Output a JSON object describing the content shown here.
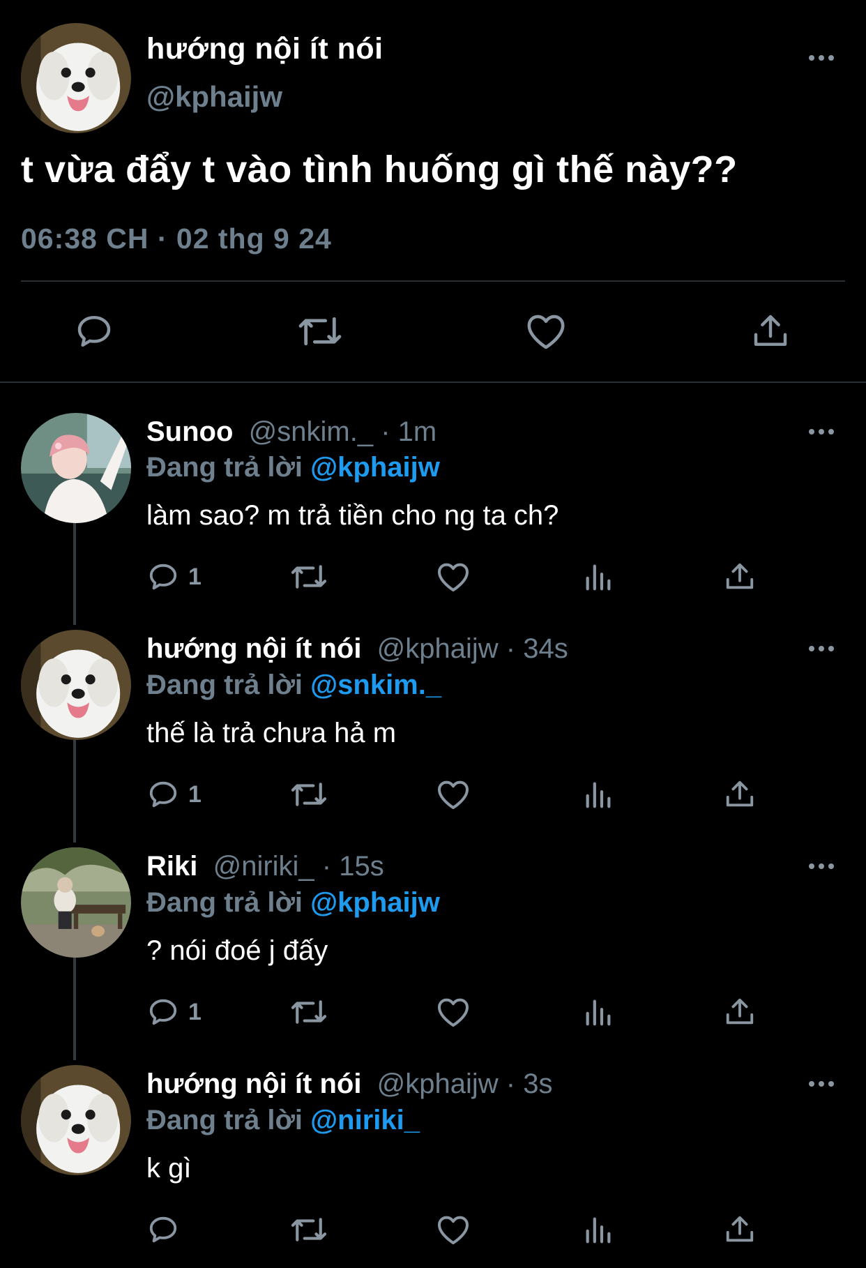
{
  "main_tweet": {
    "display_name": "hướng nội ít nói",
    "handle": "@kphaijw",
    "text": "t vừa đẩy t vào tình huống gì thế này??",
    "timestamp": "06:38 CH · 02 thg 9 24",
    "actions": [
      "reply-icon",
      "retweet-icon",
      "like-icon",
      "share-icon"
    ]
  },
  "replies": [
    {
      "display_name": "Sunoo",
      "meta": "@snkim._ · 1m",
      "replying_prefix": "Đang trả lời ",
      "replying_to": "@kphaijw",
      "text": "làm sao? m trả tiền cho ng ta ch?",
      "reply_count": "1"
    },
    {
      "display_name": "hướng nội ít nói",
      "meta": "@kphaijw · 34s",
      "replying_prefix": "Đang trả lời ",
      "replying_to": "@snkim._",
      "text": "thế là trả chưa hả m",
      "reply_count": "1"
    },
    {
      "display_name": "Riki",
      "meta": "@niriki_ · 15s",
      "replying_prefix": "Đang trả lời ",
      "replying_to": "@kphaijw",
      "text": "? nói đoé j đấy",
      "reply_count": "1"
    },
    {
      "display_name": "hướng nội ít nói",
      "meta": "@kphaijw · 3s",
      "replying_prefix": "Đang trả lời ",
      "replying_to": "@niriki_",
      "text": "k gì",
      "reply_count": ""
    }
  ],
  "colors": {
    "background": "#000000",
    "muted": "#6e7f8e",
    "mention": "#1d9bf0",
    "divider": "#2a2f33"
  }
}
